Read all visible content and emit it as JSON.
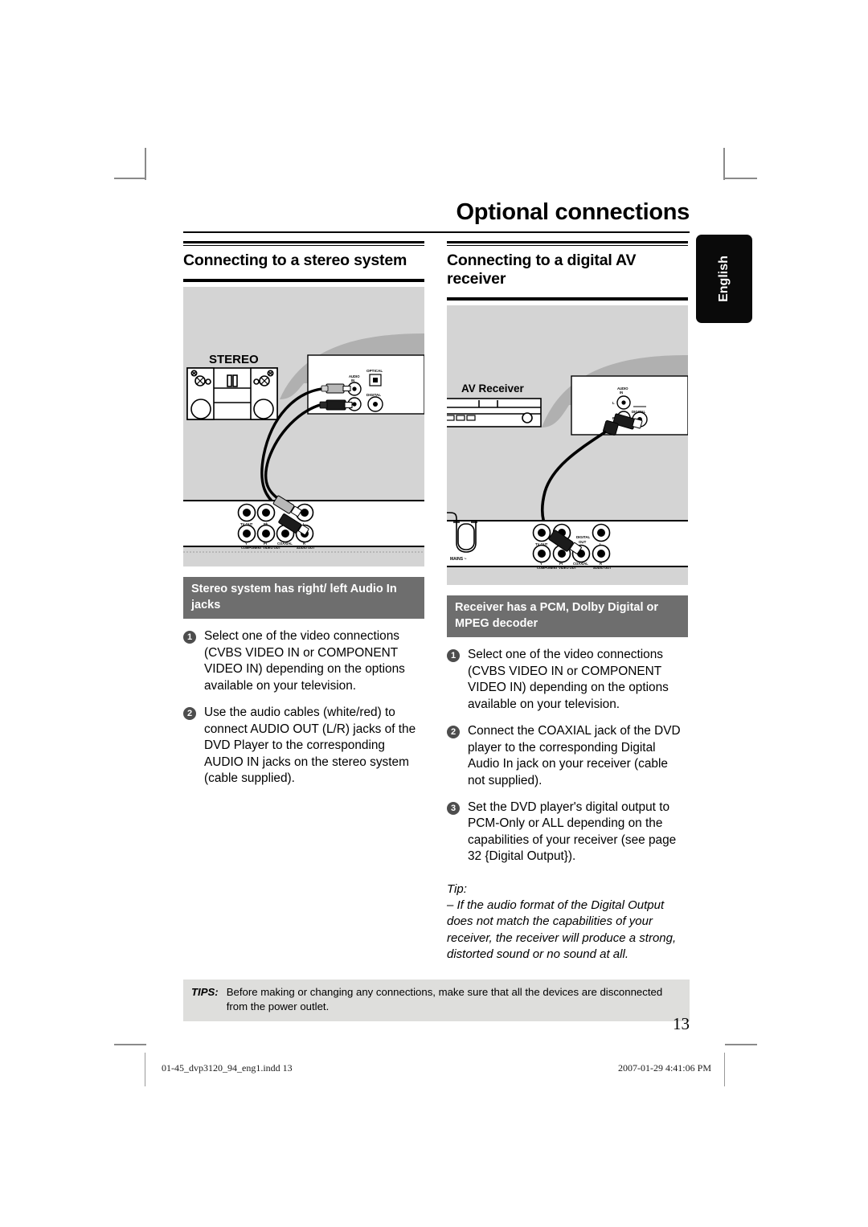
{
  "page": {
    "title": "Optional connections",
    "language_tab": "English",
    "page_number": "13"
  },
  "sections": [
    {
      "id": "stereo",
      "heading": "Connecting to a stereo system",
      "subhead": "Stereo system has right/ left Audio In jacks",
      "steps": [
        {
          "num": "1",
          "text": "Select one of the video connections (CVBS VIDEO IN or COMPONENT VIDEO IN) depending on the options available on your television."
        },
        {
          "num": "2",
          "text": "Use the audio cables (white/red) to connect AUDIO OUT (L/R) jacks of the DVD Player to the corresponding AUDIO IN jacks on the stereo system (cable supplied)."
        }
      ],
      "diagram": {
        "device_label": "STEREO",
        "panel_labels": [
          "OPTICAL",
          "DIGITAL",
          "AUDIO IN"
        ],
        "jack_labels": [
          "TV OUT",
          "Pb",
          "L",
          "Y",
          "Pr",
          "COAXIAL",
          "R"
        ],
        "jack_group_labels": [
          "COMPONENT VIDEO OUT",
          "AUDIO OUT"
        ]
      }
    },
    {
      "id": "avreceiver",
      "heading": "Connecting to a digital AV receiver",
      "subhead": "Receiver has a PCM, Dolby Digital or MPEG decoder",
      "steps": [
        {
          "num": "1",
          "text": "Select one of the video connections (CVBS VIDEO IN or COMPONENT VIDEO IN) depending on the options available on your television."
        },
        {
          "num": "2",
          "text": "Connect the COAXIAL jack of the DVD player to the corresponding Digital Audio In jack on your receiver (cable not supplied)."
        },
        {
          "num": "3",
          "text": "Set the DVD player's digital output to PCM-Only or ALL depending on the capabilities of your receiver (see page 32 {Digital Output})."
        }
      ],
      "tip": {
        "label": "Tip:",
        "text": "– If the audio format of the Digital Output does not match the capabilities of your receiver, the receiver will produce a strong, distorted sound or no sound at all."
      },
      "diagram": {
        "device_label": "AV Receiver",
        "panel_labels": [
          "AUDIO IN",
          "DIGITAL",
          "L",
          "R"
        ],
        "jack_labels": [
          "TV OUT",
          "Pb",
          "DIGITAL OUT",
          "L",
          "Y",
          "Pr",
          "COAXIAL",
          "R"
        ],
        "jack_group_labels": [
          "COMPONENT VIDEO OUT",
          "AUDIO OUT"
        ],
        "mains_label": "MAINS ~"
      }
    }
  ],
  "tips_bar": {
    "label": "TIPS:",
    "text": "Before making or changing any connections, make sure that all the devices are disconnected from the power outlet."
  },
  "print_footer": {
    "filename": "01-45_dvp3120_94_eng1.indd   13",
    "timestamp": "2007-01-29   4:41:06 PM"
  },
  "colors": {
    "diagram_bg": "#d4d4d4",
    "subhead_bg": "#6e6e6e",
    "tips_bg": "#dededc",
    "tab_bg": "#0a0a0a"
  }
}
